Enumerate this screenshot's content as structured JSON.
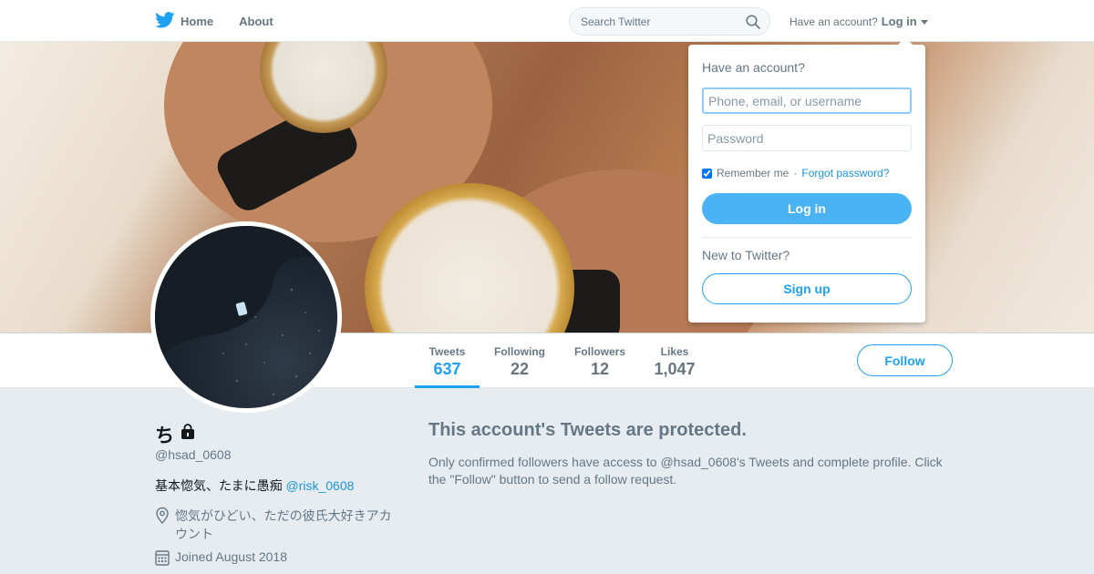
{
  "colors": {
    "accent": "#1da1f2",
    "link": "#1b95e0",
    "muted": "#657786",
    "background": "#e6ecf0"
  },
  "nav": {
    "home_label": "Home",
    "about_label": "About",
    "search_placeholder": "Search Twitter",
    "have_account_text": "Have an account?",
    "login_label": "Log in"
  },
  "login_dropdown": {
    "title": "Have an account?",
    "username_placeholder": "Phone, email, or username",
    "password_placeholder": "Password",
    "remember_me_label": "Remember me",
    "separator": "·",
    "forgot_password_label": "Forgot password?",
    "login_button_label": "Log in",
    "new_to_twitter_label": "New to Twitter?",
    "signup_button_label": "Sign up"
  },
  "stats": [
    {
      "label": "Tweets",
      "value": "637"
    },
    {
      "label": "Following",
      "value": "22"
    },
    {
      "label": "Followers",
      "value": "12"
    },
    {
      "label": "Likes",
      "value": "1,047"
    }
  ],
  "follow_button_label": "Follow",
  "profile": {
    "name": "ち",
    "handle": "@hsad_0608",
    "bio_text": "基本惚気、たまに愚痴 ",
    "bio_mention": "@risk_0608",
    "location": "惚気がひどい、ただの彼氏大好きアカウント",
    "joined": "Joined August 2018"
  },
  "protected": {
    "title": "This account's Tweets are protected.",
    "body": "Only confirmed followers have access to @hsad_0608's Tweets and complete profile. Click the \"Follow\" button to send a follow request."
  },
  "icons": [
    "twitter-bird-icon",
    "search-icon",
    "lock-icon",
    "location-pin-icon",
    "calendar-icon"
  ]
}
